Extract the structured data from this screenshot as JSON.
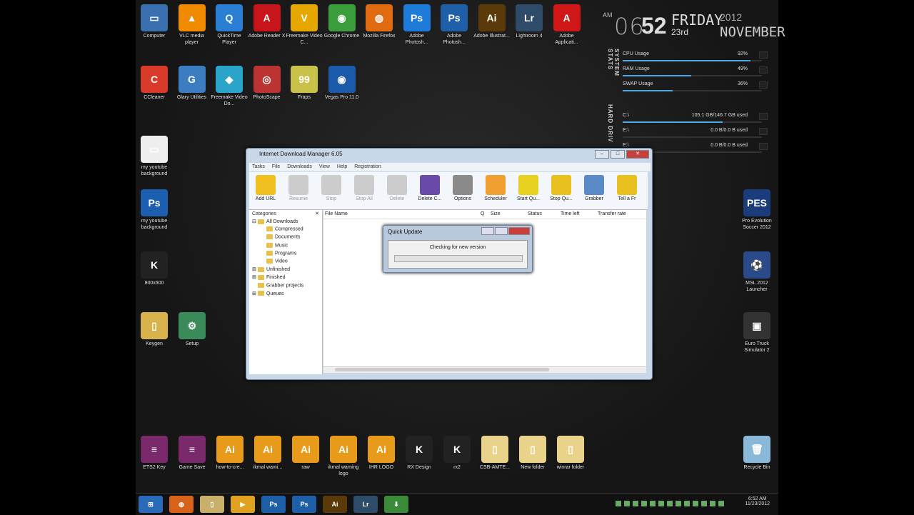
{
  "desktop": {
    "top_icons": [
      {
        "label": "Computer",
        "color": "#3a6fb0",
        "glyph": "▭"
      },
      {
        "label": "VLC media player",
        "color": "#f08a00",
        "glyph": "▲"
      },
      {
        "label": "QuickTime Player",
        "color": "#2a7fd4",
        "glyph": "Q"
      },
      {
        "label": "Adobe Reader X",
        "color": "#c8151b",
        "glyph": "A"
      },
      {
        "label": "Freemake Video C...",
        "color": "#e6a800",
        "glyph": "V"
      },
      {
        "label": "Google Chrome",
        "color": "#3b9d3b",
        "glyph": "◉"
      },
      {
        "label": "Mozilla Firefox",
        "color": "#e06b10",
        "glyph": "◍"
      },
      {
        "label": "Adobe Photosh...",
        "color": "#1f7bd8",
        "glyph": "Ps"
      },
      {
        "label": "Adobe Photosh...",
        "color": "#1f5fa8",
        "glyph": "Ps"
      },
      {
        "label": "Adobe Illustrat...",
        "color": "#5a3a08",
        "glyph": "Ai"
      },
      {
        "label": "Lightroom 4",
        "color": "#2e4b6a",
        "glyph": "Lr"
      },
      {
        "label": "Adobe Applicati...",
        "color": "#d01818",
        "glyph": "A"
      }
    ],
    "second_row_icons": [
      {
        "label": "CCleaner",
        "color": "#d93a2a",
        "glyph": "C"
      },
      {
        "label": "Glary Utilities",
        "color": "#3c7cc0",
        "glyph": "G"
      },
      {
        "label": "Freemake Video Do...",
        "color": "#2aa4c8",
        "glyph": "◆"
      },
      {
        "label": "PhotoScape",
        "color": "#b33",
        "glyph": "◎"
      },
      {
        "label": "Fraps",
        "color": "#c9c24a",
        "glyph": "99"
      },
      {
        "label": "Vegas Pro 11.0",
        "color": "#1a5aa8",
        "glyph": "◉"
      }
    ],
    "left_icons": [
      {
        "label": "my youtube background",
        "color": "#eeeeee",
        "glyph": "▭"
      },
      {
        "label": "my youtube background",
        "color": "#1c5fb0",
        "glyph": "Ps"
      },
      {
        "label": "800x600",
        "color": "#222222",
        "glyph": "K"
      },
      {
        "label": "Keygen",
        "color": "#d8b24a",
        "glyph": "▯"
      },
      {
        "label": "Setup",
        "color": "#3a8a5a",
        "glyph": "⚙"
      }
    ],
    "right_icons": [
      {
        "label": "Pro Evolution Soccer 2012",
        "color": "#1a3c7a",
        "glyph": "PES"
      },
      {
        "label": "MSL 2012 Launcher",
        "color": "#2a4a8a",
        "glyph": "⚽"
      },
      {
        "label": "Euro Truck Simulator 2",
        "color": "#333333",
        "glyph": "▣"
      }
    ],
    "bottom_icons": [
      {
        "label": "ETS2 Key",
        "color": "#7a2a6a",
        "glyph": "≡"
      },
      {
        "label": "Game Save",
        "color": "#7a2a6a",
        "glyph": "≡"
      },
      {
        "label": "how-to-cre...",
        "color": "#e89a1a",
        "glyph": "Ai"
      },
      {
        "label": "ikmal wami...",
        "color": "#e89a1a",
        "glyph": "Ai"
      },
      {
        "label": "raw",
        "color": "#e89a1a",
        "glyph": "Ai"
      },
      {
        "label": "ikmal warning logo",
        "color": "#e89a1a",
        "glyph": "Ai"
      },
      {
        "label": "IHR LOGO",
        "color": "#e89a1a",
        "glyph": "Ai"
      },
      {
        "label": "RX Design",
        "color": "#222222",
        "glyph": "K"
      },
      {
        "label": "rx2",
        "color": "#222222",
        "glyph": "K"
      },
      {
        "label": "CSB-AMTE...",
        "color": "#e9d38a",
        "glyph": "▯"
      },
      {
        "label": "New folder",
        "color": "#e9d38a",
        "glyph": "▯"
      },
      {
        "label": "winrar folder",
        "color": "#e9d38a",
        "glyph": "▯"
      },
      {
        "label": "Recycle Bin",
        "color": "#8ab8d8",
        "glyph": "🗑"
      }
    ]
  },
  "clock": {
    "ampm": "AM",
    "hour": "06",
    "minute": "52",
    "day": "FRIDAY",
    "date": "23rd",
    "year": "2012",
    "month": "NOVEMBER"
  },
  "stats": {
    "side_label": "SYSTEM STATS",
    "side_label2": "HARD DRIV",
    "rows": [
      {
        "name": "CPU Usage",
        "value": "92%",
        "fill": 0.92
      },
      {
        "name": "RAM Usage",
        "value": "49%",
        "fill": 0.49
      },
      {
        "name": "SWAP Usage",
        "value": "36%",
        "fill": 0.36
      }
    ],
    "drives": [
      {
        "name": "C:\\",
        "value": "105.1 GB/146.7 GB used",
        "fill": 0.72
      },
      {
        "name": "E:\\",
        "value": "0.0 B/0.0 B used",
        "fill": 0.0
      },
      {
        "name": "E:\\",
        "value": "0.0 B/0.0 B used",
        "fill": 0.0
      }
    ]
  },
  "idm": {
    "title": "Internet Download Manager 6.05",
    "menu": [
      "Tasks",
      "File",
      "Downloads",
      "View",
      "Help",
      "Registration"
    ],
    "toolbar": [
      {
        "label": "Add URL",
        "color": "#f0c020",
        "disabled": false
      },
      {
        "label": "Resume",
        "color": "#cccccc",
        "disabled": true
      },
      {
        "label": "Stop",
        "color": "#cccccc",
        "disabled": true
      },
      {
        "label": "Stop All",
        "color": "#cccccc",
        "disabled": true
      },
      {
        "label": "Delete",
        "color": "#cccccc",
        "disabled": true
      },
      {
        "label": "Delete C...",
        "color": "#6a4aa8",
        "disabled": false
      },
      {
        "label": "Options",
        "color": "#8a8a8a",
        "disabled": false
      },
      {
        "label": "Scheduler",
        "color": "#f0a030",
        "disabled": false
      },
      {
        "label": "Start Qu...",
        "color": "#e8d020",
        "disabled": false
      },
      {
        "label": "Stop Qu...",
        "color": "#e8c020",
        "disabled": false
      },
      {
        "label": "Grabber",
        "color": "#5a8ac8",
        "disabled": false
      },
      {
        "label": "Tell a Fr",
        "color": "#e8c020",
        "disabled": false
      }
    ],
    "categories_header": "Categories",
    "close_x": "✕",
    "tree": [
      {
        "label": "All Downloads",
        "indent": 0,
        "toggle": "⊟"
      },
      {
        "label": "Compressed",
        "indent": 1,
        "toggle": ""
      },
      {
        "label": "Documents",
        "indent": 1,
        "toggle": ""
      },
      {
        "label": "Music",
        "indent": 1,
        "toggle": ""
      },
      {
        "label": "Programs",
        "indent": 1,
        "toggle": ""
      },
      {
        "label": "Video",
        "indent": 1,
        "toggle": ""
      },
      {
        "label": "Unfinished",
        "indent": 0,
        "toggle": "⊞"
      },
      {
        "label": "Finished",
        "indent": 0,
        "toggle": "⊞"
      },
      {
        "label": "Grabber projects",
        "indent": 0,
        "toggle": ""
      },
      {
        "label": "Queues",
        "indent": 0,
        "toggle": "⊞"
      }
    ],
    "columns": [
      "File Name",
      "Q",
      "Size",
      "Status",
      "Time left",
      "Transfer rate"
    ]
  },
  "dialog": {
    "title": "Quick Update",
    "message": "Checking for new version",
    "progress": 0.0
  },
  "taskbar": {
    "items": [
      {
        "name": "start-orb",
        "color": "#2a6ab8",
        "glyph": "⊞"
      },
      {
        "name": "firefox",
        "color": "#d9621a",
        "glyph": "◍"
      },
      {
        "name": "explorer",
        "color": "#c9b06a",
        "glyph": "▯"
      },
      {
        "name": "media-player",
        "color": "#e0a020",
        "glyph": "▶"
      },
      {
        "name": "photoshop-1",
        "color": "#1f5fa8",
        "glyph": "Ps"
      },
      {
        "name": "photoshop-2",
        "color": "#1f5fa8",
        "glyph": "Ps"
      },
      {
        "name": "illustrator",
        "color": "#5a3a08",
        "glyph": "Ai"
      },
      {
        "name": "lightroom",
        "color": "#2e4b6a",
        "glyph": "Lr"
      },
      {
        "name": "idm",
        "color": "#3a8a3a",
        "glyph": "⬇"
      }
    ],
    "time": "6:52 AM",
    "date": "11/23/2012"
  }
}
